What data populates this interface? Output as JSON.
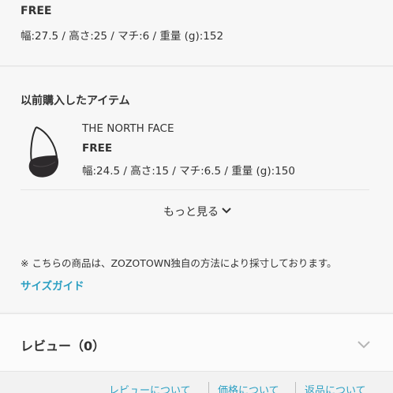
{
  "current_item": {
    "size": "FREE",
    "measurements": "幅:27.5 / 高さ:25 / マチ:6 / 重量 (g):152"
  },
  "history": {
    "heading": "以前購入したアイテム",
    "item": {
      "brand": "THE NORTH FACE",
      "size": "FREE",
      "measurements": "幅:24.5 / 高さ:15 / マチ:6.5 / 重量 (g):150",
      "image_icon": "shoulder-bag-icon"
    },
    "more_label": "もっと見る"
  },
  "note": "※ こちらの商品は、ZOZOTOWN独自の方法により採寸しております。",
  "size_guide_label": "サイズガイド",
  "review": {
    "label": "レビュー（0）"
  },
  "bottom_links": [
    "レビューについて",
    "価格について",
    "返品について"
  ],
  "colors": {
    "accent": "#2b9fc2",
    "text": "#333333",
    "background": "#f7f7f7"
  }
}
